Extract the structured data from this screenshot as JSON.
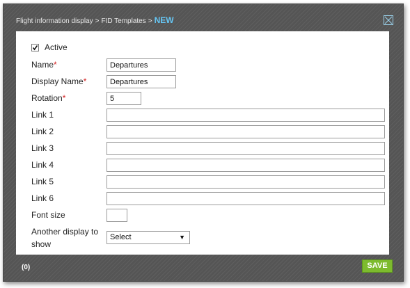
{
  "breadcrumb": {
    "items": [
      "Flight information display",
      "FID Templates"
    ],
    "separator": ">",
    "current": "NEW"
  },
  "form": {
    "active": {
      "label": "Active",
      "checked": true
    },
    "name": {
      "label": "Name",
      "required": "*",
      "value": "Departures"
    },
    "display_name": {
      "label": "Display Name",
      "required": "*",
      "value": "Departures"
    },
    "rotation": {
      "label": "Rotation",
      "required": "*",
      "value": "5"
    },
    "links": [
      {
        "label": "Link 1",
        "value": ""
      },
      {
        "label": "Link 2",
        "value": ""
      },
      {
        "label": "Link 3",
        "value": ""
      },
      {
        "label": "Link 4",
        "value": ""
      },
      {
        "label": "Link 5",
        "value": ""
      },
      {
        "label": "Link 6",
        "value": ""
      }
    ],
    "font_size": {
      "label": "Font size",
      "value": ""
    },
    "another_display": {
      "label_line1": "Another display to",
      "label_line2": "show",
      "selected": "Select",
      "arrow": "▼"
    }
  },
  "footer": {
    "count": "(0)",
    "save_label": "SAVE"
  },
  "colors": {
    "accent": "#66c6f4",
    "save": "#7dbb2e",
    "required": "#d42020",
    "backdrop": "#555555"
  },
  "icons": {
    "close": "close-icon",
    "check": "checkmark-icon"
  }
}
